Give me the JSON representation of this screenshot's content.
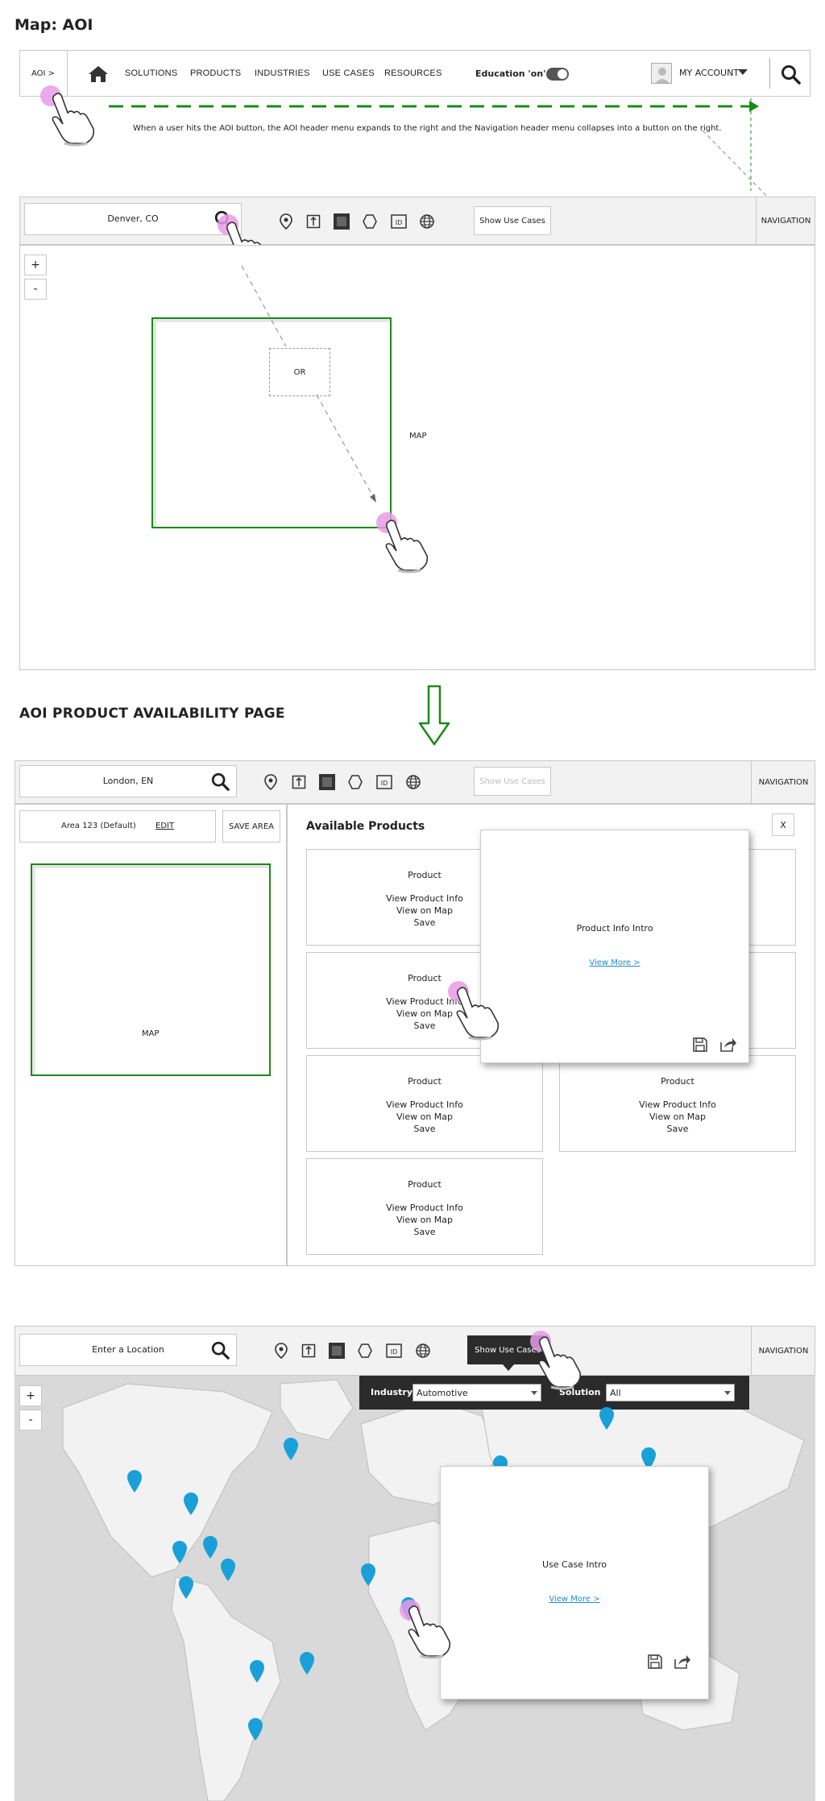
{
  "page_title": "Map: AOI",
  "colors": {
    "accent_green": "#1a8a1a",
    "pink_touch": "#e79be7",
    "pin_blue": "#1aa0d8",
    "dark_bar": "#2b2b2b",
    "map_gray": "#c9c9c9"
  },
  "header1": {
    "aoi_button": "AOI >",
    "menu": [
      "SOLUTIONS",
      "PRODUCTS",
      "INDUSTRIES",
      "USE CASES",
      "RESOURCES"
    ],
    "education_label": "Education 'on'",
    "account_label": "MY ACCOUNT",
    "note": "When a user hits the AOI button, the AOI header menu expands to the right and the Navigation header menu collapses into a button on the right."
  },
  "section1": {
    "search_value": "Denver, CO",
    "show_use_cases": "Show Use Cases",
    "navigation": "NAVIGATION",
    "zoom_in": "+",
    "zoom_out": "-",
    "or_label": "OR",
    "map_label": "MAP"
  },
  "section2": {
    "title": "AOI PRODUCT AVAILABILITY PAGE",
    "search_value": "London, EN",
    "show_use_cases": "Show Use Cases",
    "navigation": "NAVIGATION",
    "area_name": "Area 123 (Default)",
    "edit": "EDIT",
    "save_area": "SAVE AREA",
    "map_label": "MAP",
    "available_products": "Available Products",
    "close": "X",
    "product_title": "Product",
    "product_links": [
      "View Product Info",
      "View on Map",
      "Save"
    ],
    "popup_intro": "Product Info Intro",
    "popup_link": "View More >"
  },
  "section3": {
    "search_placeholder": "Enter a Location",
    "show_use_cases": "Show Use Cases",
    "navigation": "NAVIGATION",
    "zoom_in": "+",
    "zoom_out": "-",
    "industry_label": "Industry",
    "industry_value": "Automotive",
    "solution_label": "Solution",
    "solution_value": "All",
    "popup_intro": "Use Case Intro",
    "popup_link": "View More >"
  }
}
